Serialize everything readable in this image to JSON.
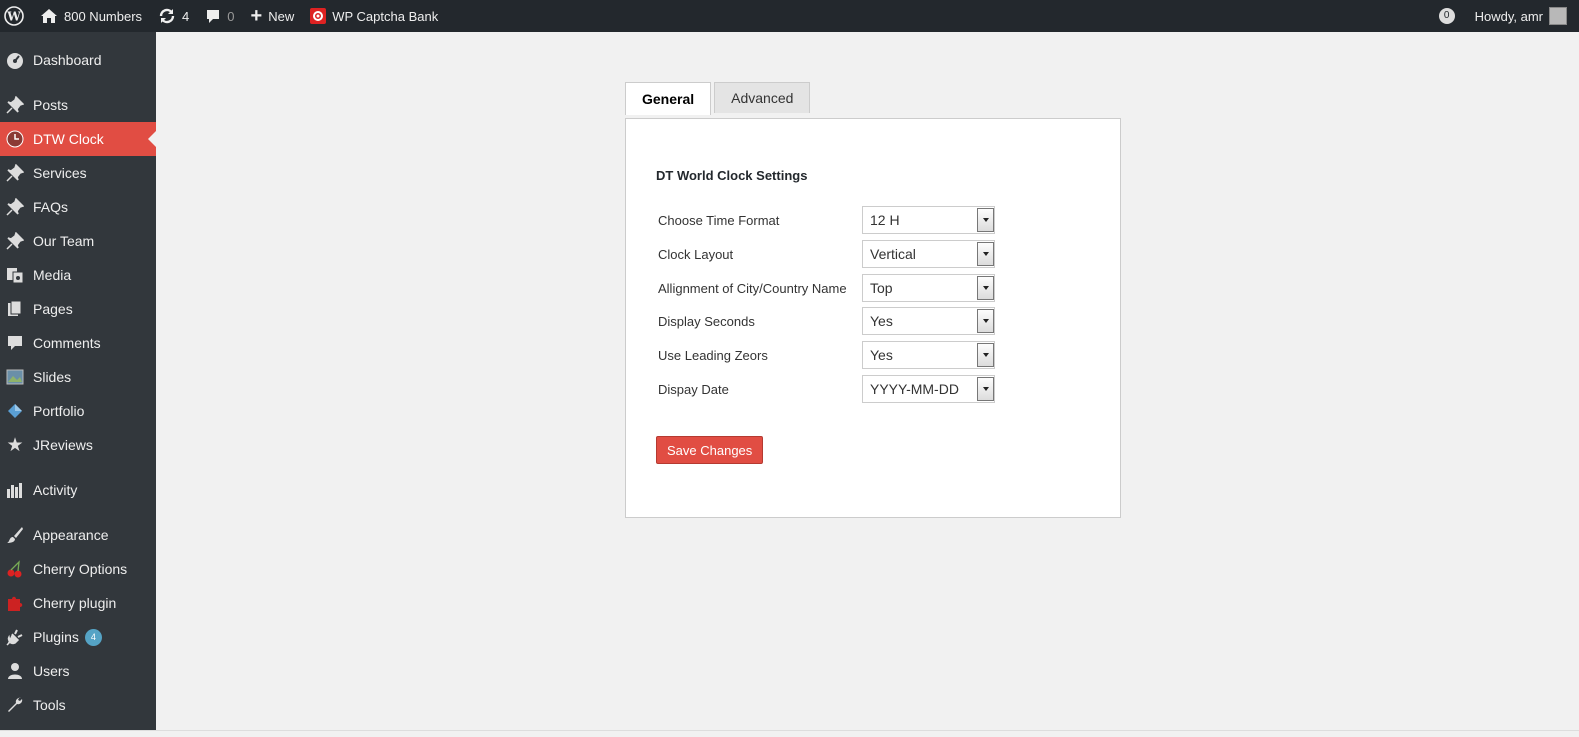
{
  "adminbar": {
    "site_name": "800 Numbers",
    "updates_count": "4",
    "comments_count": "0",
    "new_label": "New",
    "captcha_label": "WP Captcha Bank",
    "notifications_count": "0",
    "howdy": "Howdy, amr"
  },
  "sidebar": {
    "items": [
      {
        "label": "Dashboard"
      },
      {
        "label": "Posts"
      },
      {
        "label": "DTW Clock"
      },
      {
        "label": "Services"
      },
      {
        "label": "FAQs"
      },
      {
        "label": "Our Team"
      },
      {
        "label": "Media"
      },
      {
        "label": "Pages"
      },
      {
        "label": "Comments"
      },
      {
        "label": "Slides"
      },
      {
        "label": "Portfolio"
      },
      {
        "label": "JReviews"
      },
      {
        "label": "Activity"
      },
      {
        "label": "Appearance"
      },
      {
        "label": "Cherry Options"
      },
      {
        "label": "Cherry plugin"
      },
      {
        "label": "Plugins",
        "badge": "4"
      },
      {
        "label": "Users"
      },
      {
        "label": "Tools"
      }
    ]
  },
  "tabs": {
    "general": "General",
    "advanced": "Advanced"
  },
  "settings": {
    "heading": "DT World Clock Settings",
    "rows": [
      {
        "label": "Choose Time Format",
        "value": "12 H"
      },
      {
        "label": "Clock Layout",
        "value": "Vertical"
      },
      {
        "label": "Allignment of City/Country Name",
        "value": "Top"
      },
      {
        "label": "Display Seconds",
        "value": "Yes"
      },
      {
        "label": "Use Leading Zeors",
        "value": "Yes"
      },
      {
        "label": "Dispay Date",
        "value": "YYYY-MM-DD"
      }
    ],
    "save_label": "Save Changes"
  },
  "colors": {
    "accent": "#e14d43",
    "sidebar_bg": "#32373c",
    "adminbar_bg": "#23282d",
    "badge": "#55a3c5"
  }
}
